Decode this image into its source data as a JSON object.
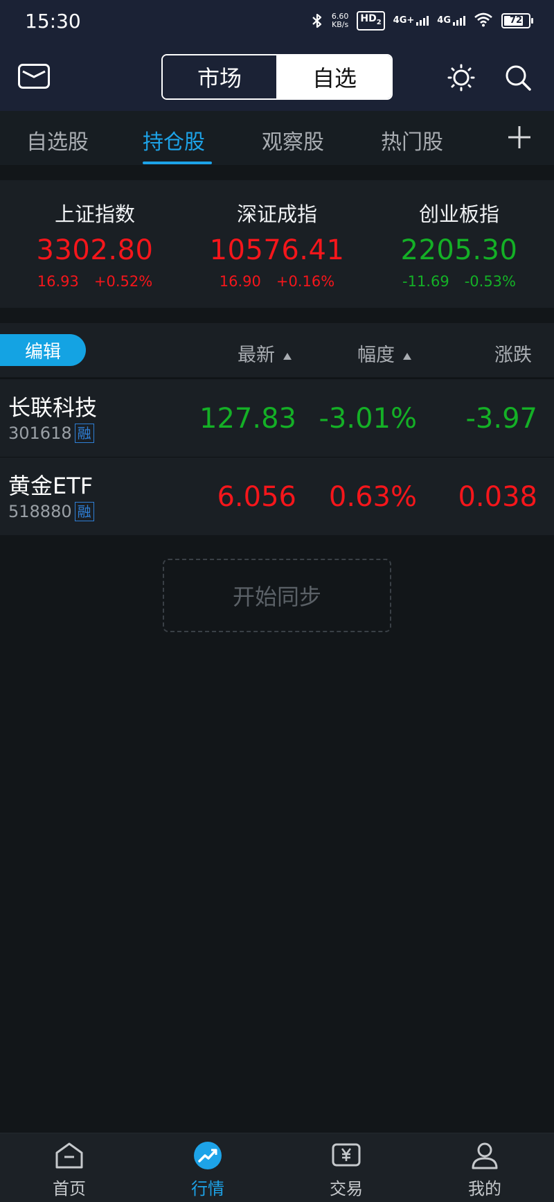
{
  "status_bar": {
    "time": "15:30",
    "net_speed_value": "6.60",
    "net_speed_unit": "KB/s",
    "hd_label": "HD",
    "hd_sub": "2",
    "sim1_label": "4G+",
    "sim2_label": "4G",
    "battery": "72"
  },
  "header": {
    "segments": [
      "市场",
      "自选"
    ],
    "active_segment": "自选"
  },
  "sub_tabs": {
    "items": [
      "自选股",
      "持仓股",
      "观察股",
      "热门股"
    ],
    "active": "持仓股"
  },
  "indices": [
    {
      "name": "上证指数",
      "value": "3302.80",
      "change": "16.93",
      "pct": "+0.52%",
      "trend": "up"
    },
    {
      "name": "深证成指",
      "value": "10576.41",
      "change": "16.90",
      "pct": "+0.16%",
      "trend": "up"
    },
    {
      "name": "创业板指",
      "value": "2205.30",
      "change": "-11.69",
      "pct": "-0.53%",
      "trend": "down"
    }
  ],
  "list_header": {
    "edit_label": "编辑",
    "col_latest": "最新",
    "col_range": "幅度",
    "col_change": "涨跌"
  },
  "stocks": [
    {
      "name": "长联科技",
      "code": "301618",
      "tag": "融",
      "latest": "127.83",
      "pct": "-3.01%",
      "change": "-3.97",
      "trend": "down"
    },
    {
      "name": "黄金ETF",
      "code": "518880",
      "tag": "融",
      "latest": "6.056",
      "pct": "0.63%",
      "change": "0.038",
      "trend": "up"
    }
  ],
  "sync_button": "开始同步",
  "bottom_nav": {
    "items": [
      "首页",
      "行情",
      "交易",
      "我的"
    ],
    "active": "行情"
  },
  "colors": {
    "up": "#f5161b",
    "down": "#14b026",
    "accent": "#1da3e8",
    "header_bg": "#1b2235"
  }
}
